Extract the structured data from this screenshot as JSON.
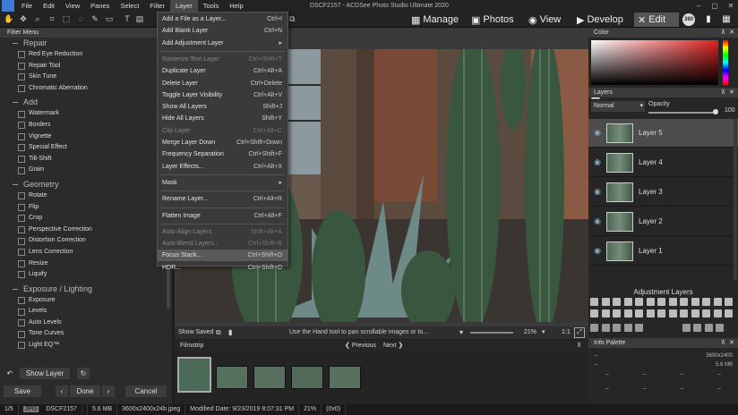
{
  "menubar": {
    "items": [
      "File",
      "Edit",
      "View",
      "Panes",
      "Select",
      "Filter",
      "Layer",
      "Tools",
      "Help"
    ],
    "active": "Layer"
  },
  "window_title": "DSCF2157 - ACDSee Photo Studio Ultimate 2020",
  "modes": {
    "manage": "Manage",
    "photos": "Photos",
    "view": "View",
    "develop": "Develop",
    "edit": "Edit",
    "badge360": "360"
  },
  "filter_menu": {
    "header": "Filter Menu",
    "sections": [
      {
        "title": "Repair",
        "items": [
          "Red Eye Reduction",
          "Repair Tool",
          "Skin Tune",
          "Chromatic Aberration"
        ]
      },
      {
        "title": "Add",
        "items": [
          "Watermark",
          "Borders",
          "Vignette",
          "Special Effect",
          "Tilt-Shift",
          "Grain"
        ]
      },
      {
        "title": "Geometry",
        "items": [
          "Rotate",
          "Flip",
          "Crop",
          "Perspective Correction",
          "Distortion Correction",
          "Lens Correction",
          "Resize",
          "Liquify"
        ]
      },
      {
        "title": "Exposure / Lighting",
        "items": [
          "Exposure",
          "Levels",
          "Auto Levels",
          "Tone Curves",
          "Light EQ™"
        ]
      }
    ]
  },
  "left_bottom": {
    "show_layer": "Show Layer",
    "save": "Save",
    "done": "Done",
    "cancel": "Cancel"
  },
  "layer_menu": [
    {
      "label": "Add a File as a Layer...",
      "shortcut": "Ctrl+I"
    },
    {
      "label": "Add Blank Layer",
      "shortcut": "Ctrl+N"
    },
    {
      "label": "Add Adjustment Layer",
      "shortcut": "▸"
    },
    {
      "sep": true
    },
    {
      "label": "Rasterize Text Layer",
      "shortcut": "Ctrl+Shift+T",
      "disabled": true
    },
    {
      "label": "Duplicate Layer",
      "shortcut": "Ctrl+Alt+A"
    },
    {
      "label": "Delete Layer",
      "shortcut": "Ctrl+Delete"
    },
    {
      "label": "Toggle Layer Visibility",
      "shortcut": "Ctrl+Alt+V"
    },
    {
      "label": "Show All Layers",
      "shortcut": "Shift+J"
    },
    {
      "label": "Hide All Layers",
      "shortcut": "Shift+Y"
    },
    {
      "label": "Clip Layer",
      "shortcut": "Ctrl+Alt+C",
      "disabled": true
    },
    {
      "label": "Merge Layer Down",
      "shortcut": "Ctrl+Shift+Down"
    },
    {
      "label": "Frequency Separation",
      "shortcut": "Ctrl+Shift+F"
    },
    {
      "label": "Layer Effects...",
      "shortcut": "Ctrl+Alt+X"
    },
    {
      "sep": true
    },
    {
      "label": "Mask",
      "shortcut": "▸"
    },
    {
      "sep": true
    },
    {
      "label": "Rename Layer...",
      "shortcut": "Ctrl+Alt+R"
    },
    {
      "sep": true
    },
    {
      "label": "Flatten Image",
      "shortcut": "Ctrl+Alt+F"
    },
    {
      "sep": true
    },
    {
      "label": "Auto-Align Layers",
      "shortcut": "Shift+Alt+A",
      "disabled": true
    },
    {
      "label": "Auto-Blend Layers...",
      "shortcut": "Ctrl+Shift+B",
      "disabled": true
    },
    {
      "label": "Focus Stack...",
      "shortcut": "Ctrl+Shift+O",
      "highlight": true
    },
    {
      "label": "HDR...",
      "shortcut": "Ctrl+Shift+D"
    }
  ],
  "canvas": {
    "show_saved": "Show Saved",
    "hint": "Use the Hand tool to pan scrollable images or to...",
    "zoom": "21%",
    "ratio": "1:1"
  },
  "filmstrip": {
    "title": "Filmstrip",
    "previous": "Previous",
    "next": "Next"
  },
  "color_panel": {
    "title": "Color"
  },
  "layers_panel": {
    "title": "Layers",
    "blend_mode": "Normal",
    "opacity_label": "Opacity",
    "opacity_value": "100",
    "layers": [
      "Layer 5",
      "Layer 4",
      "Layer 3",
      "Layer 2",
      "Layer 1"
    ],
    "selected": "Layer 5"
  },
  "adjustment_layers": {
    "title": "Adjustment Layers"
  },
  "info_palette": {
    "title": "Info Palette",
    "dims": "3600x2400",
    "size": "5.6 MB",
    "dash": "--"
  },
  "status": {
    "count": "1/5",
    "format": "JPG",
    "filename": "DSCF2157",
    "filesize": "5.6 MB",
    "image_info": "3600x2400x24b jpeg",
    "modified": "Modified Date: 9/23/2019 8:07:31 PM",
    "zoom": "21%",
    "coords": "(0x0)"
  },
  "colors": {
    "accent": "#5a5a5a",
    "selected_layer": "#4c4c4c"
  }
}
